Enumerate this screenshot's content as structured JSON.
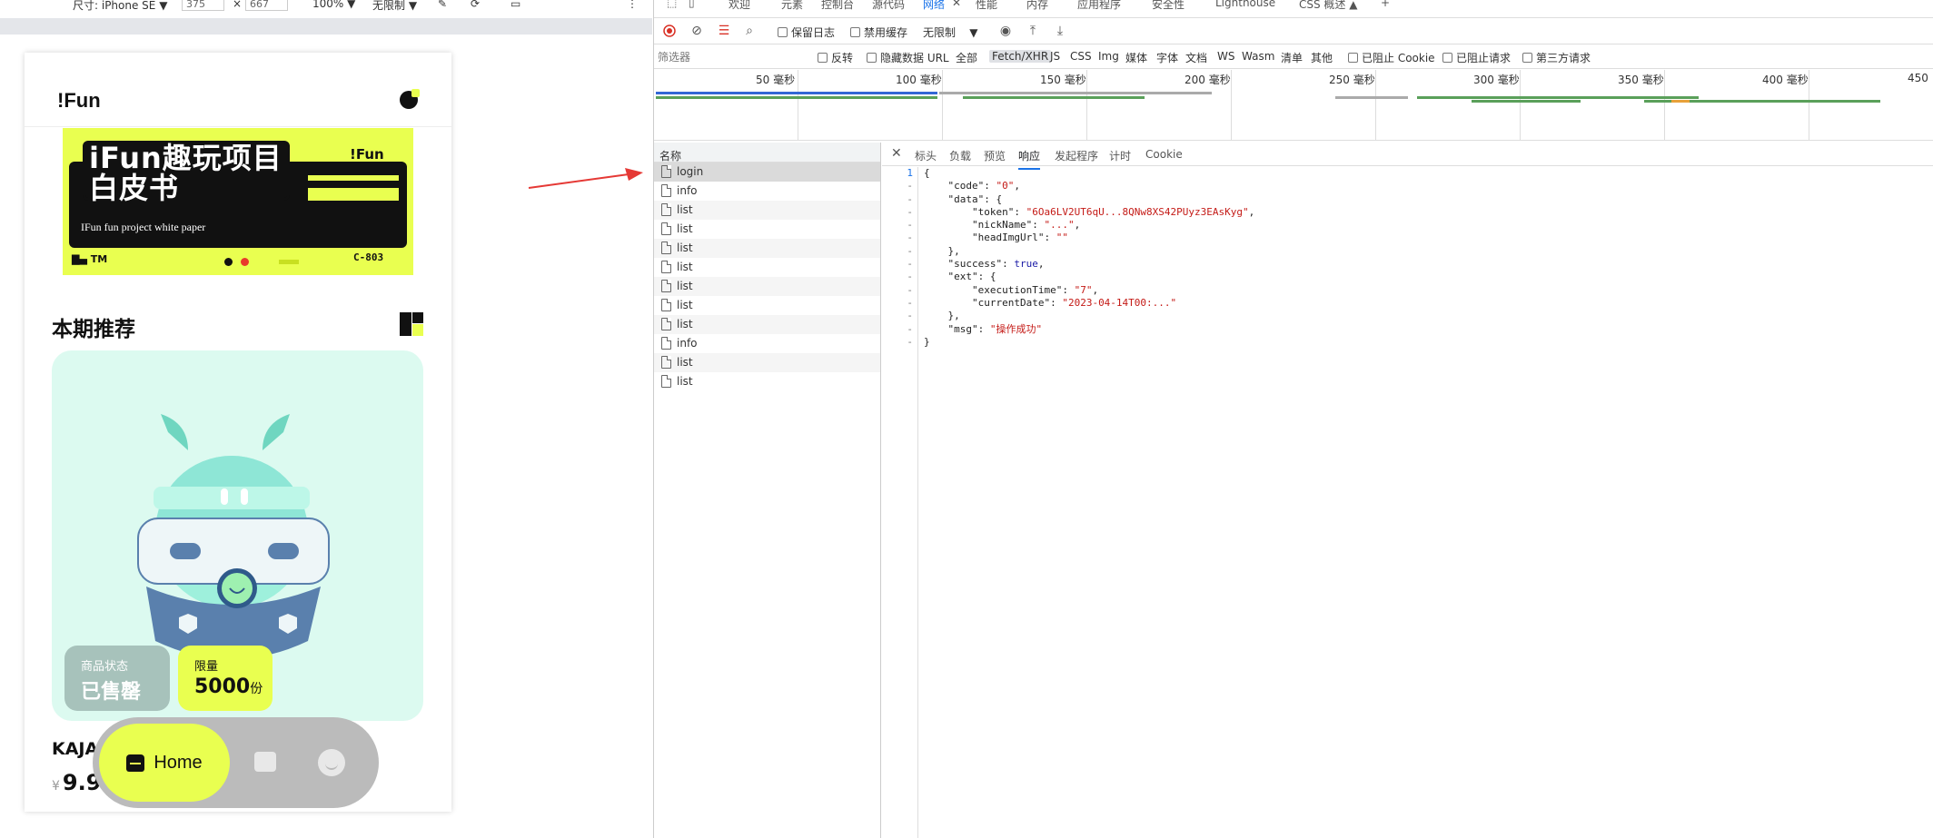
{
  "device_toolbar": {
    "dimensions_label": "尺寸: iPhone SE",
    "width": "375",
    "times": "×",
    "height": "667",
    "zoom": "100%",
    "throttle": "无限制",
    "more": "⋮"
  },
  "phone": {
    "logo": "!Fun",
    "banner": {
      "title": "iFun趣玩项目白皮书",
      "subtitle": "IFun fun project white paper",
      "brand": "!Fun",
      "tm": "TM",
      "code": "C-803"
    },
    "section_title": "本期推荐",
    "badge_status": {
      "label": "商品状态",
      "value": "已售罄"
    },
    "badge_limit": {
      "label": "限量",
      "value": "5000",
      "unit": "份"
    },
    "product_name": "KAJA",
    "price_symbol": "¥",
    "price": "9.9",
    "tabbar": {
      "home_label": "Home"
    }
  },
  "devtools": {
    "tabs": [
      "欢迎",
      "元素",
      "控制台",
      "源代码",
      "网络",
      "性能",
      "内存",
      "应用程序",
      "安全性",
      "Lighthouse",
      "CSS 概述 ▲"
    ],
    "active_tab": "网络",
    "toolbar": {
      "preserve_log": "保留日志",
      "disable_cache": "禁用缓存",
      "throttle": "无限制"
    },
    "filter": {
      "placeholder": "筛选器",
      "invert": "反转",
      "hide_data_url": "隐藏数据 URL",
      "types": [
        "全部",
        "Fetch/XHR",
        "JS",
        "CSS",
        "Img",
        "媒体",
        "字体",
        "文档",
        "WS",
        "Wasm",
        "清单",
        "其他"
      ],
      "selected_type": "Fetch/XHR",
      "blocked_cookies": "已阻止 Cookie",
      "blocked_requests": "已阻止请求",
      "third_party": "第三方请求"
    },
    "timeline_ticks": [
      "50 毫秒",
      "100 毫秒",
      "150 毫秒",
      "200 毫秒",
      "250 毫秒",
      "300 毫秒",
      "350 毫秒",
      "400 毫秒",
      "450"
    ],
    "request_list": {
      "header": "名称",
      "items": [
        "login",
        "info",
        "list",
        "list",
        "list",
        "list",
        "list",
        "list",
        "list",
        "info",
        "list",
        "list"
      ],
      "selected_index": 0
    },
    "detail_tabs": [
      "标头",
      "负载",
      "预览",
      "响应",
      "发起程序",
      "计时",
      "Cookie"
    ],
    "active_detail_tab": "响应",
    "response_lines": [
      "{",
      "    \"code\": \"0\",",
      "    \"data\": {",
      "        \"token\": \"6Oa6LV2UT6qU...8QNw8XS42PUyz3EAsKyg\",",
      "        \"nickName\": \"...\",",
      "        \"headImgUrl\": \"\"",
      "    },",
      "    \"success\": true,",
      "    \"ext\": {",
      "        \"executionTime\": \"7\",",
      "        \"currentDate\": \"2023-04-14T00:...\"",
      "    },",
      "    \"msg\": \"操作成功\"",
      "}"
    ],
    "gutter": [
      "1",
      "-",
      "-",
      "-",
      "-",
      "-",
      "-",
      "-",
      "-",
      "-",
      "-",
      "-",
      "-",
      "-"
    ]
  },
  "colors": {
    "accent_yellow": "#e9ff50",
    "mint": "#dcfaf0",
    "devtools_blue": "#1a73e8",
    "string_red": "#c41a16"
  }
}
